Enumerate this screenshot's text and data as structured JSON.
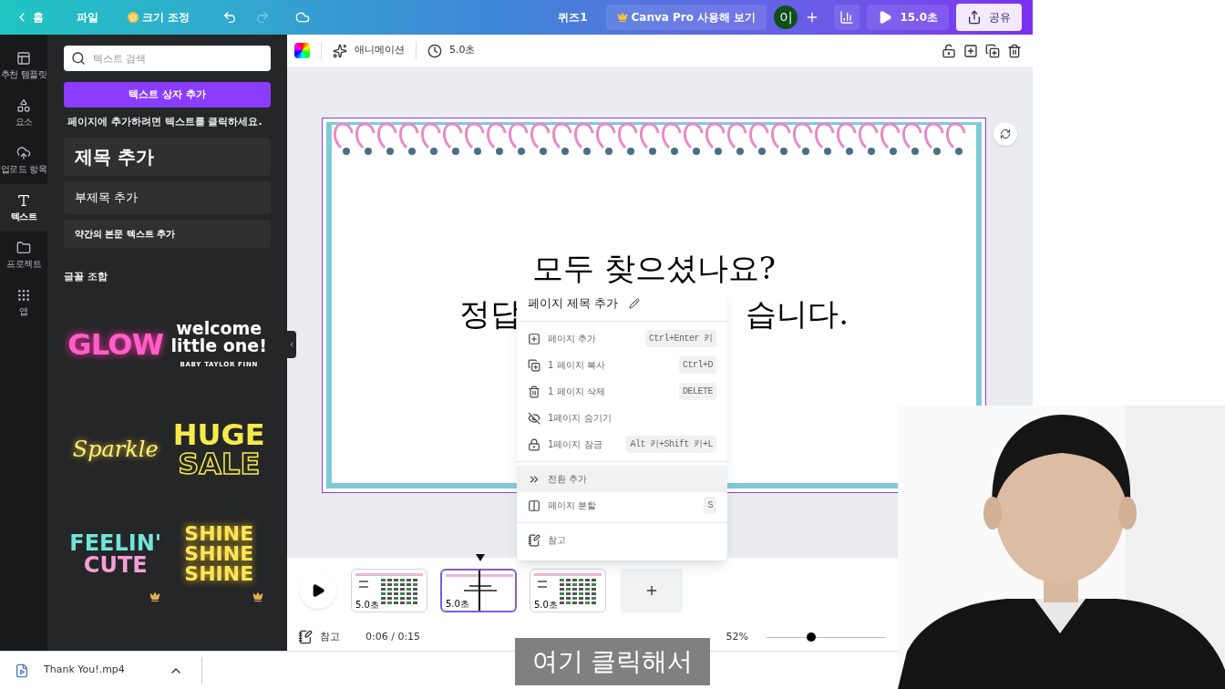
{
  "topbar": {
    "back": "홈",
    "file": "파일",
    "resize": "크기 조정",
    "title": "퀴즈1",
    "pro": "Canva Pro 사용해 보기",
    "avatar": "이",
    "present": "15.0초",
    "share": "공유",
    "redo_disabled": true
  },
  "rail": [
    {
      "label": "추천 템플릿",
      "selected": false
    },
    {
      "label": "요소",
      "selected": false
    },
    {
      "label": "업로드 항목",
      "selected": false
    },
    {
      "label": "텍스트",
      "selected": true
    },
    {
      "label": "프로젝트",
      "selected": false
    },
    {
      "label": "앱",
      "selected": false
    }
  ],
  "panel": {
    "search_placeholder": "텍스트 검색",
    "add_button": "텍스트 상자 추가",
    "hint": "페이지에 추가하려면 텍스트를 클릭하세요.",
    "presets": [
      {
        "kind": "heading",
        "label": "제목 추가"
      },
      {
        "kind": "subheading",
        "label": "부제목 추가"
      },
      {
        "kind": "body",
        "label": "약간의 본문 텍스트 추가"
      }
    ],
    "combos_title": "글꼴 조합",
    "combos": [
      {
        "kind": "glow",
        "lines": [
          "GLOW"
        ],
        "premium": false
      },
      {
        "kind": "welcome",
        "lines": [
          "welcome",
          "little one!",
          "BABY TAYLOR FINN"
        ],
        "premium": false
      },
      {
        "kind": "script",
        "lines": [
          "Sparkle"
        ],
        "premium": false
      },
      {
        "kind": "sale",
        "lines": [
          "HUGE",
          "SALE"
        ],
        "premium": false
      },
      {
        "kind": "cute",
        "lines": [
          "FEELIN'",
          "CUTE"
        ],
        "premium": true
      },
      {
        "kind": "shine",
        "lines": [
          "SHINE",
          "SHINE",
          "SHINE"
        ],
        "premium": true
      }
    ]
  },
  "toolbar": {
    "animate": "애니메이션",
    "duration": "5.0초"
  },
  "slide": {
    "line1": "모두 찾으셨나요?",
    "line2_start": "정답",
    "line2_end": "습니다."
  },
  "menu": {
    "title": "페이지 제목 추가",
    "groups": [
      [
        {
          "label": "페이지 추가",
          "shortcut": "Ctrl+Enter 키",
          "highlighted": false
        },
        {
          "label": "1 페이지 복사",
          "shortcut": "Ctrl+D",
          "highlighted": false
        },
        {
          "label": "1 페이지 삭제",
          "shortcut": "DELETE",
          "highlighted": false
        },
        {
          "label": "1페이지 숨기기",
          "highlighted": false
        },
        {
          "label": "1페이지 잠금",
          "shortcut": "Alt 키+Shift 키+L",
          "highlighted": false
        }
      ],
      [
        {
          "label": "전환 추가",
          "highlighted": true
        },
        {
          "label": "페이지 분할",
          "shortcut": "S",
          "highlighted": false
        }
      ],
      [
        {
          "label": "참고",
          "highlighted": false
        }
      ]
    ]
  },
  "timeline": {
    "pages": [
      {
        "kind": "grid",
        "duration": "5.0초",
        "selected": false
      },
      {
        "kind": "text",
        "duration": "5.0초",
        "selected": true
      },
      {
        "kind": "grid",
        "duration": "5.0초",
        "selected": false
      }
    ]
  },
  "footer": {
    "notes": "참고",
    "time": "0:06 / 0:15",
    "zoom": "52%",
    "zoom_slider": {
      "level": 0.38
    }
  },
  "download": {
    "file": "Thank You!.mp4"
  },
  "subtitle": "여기 클릭해서"
}
